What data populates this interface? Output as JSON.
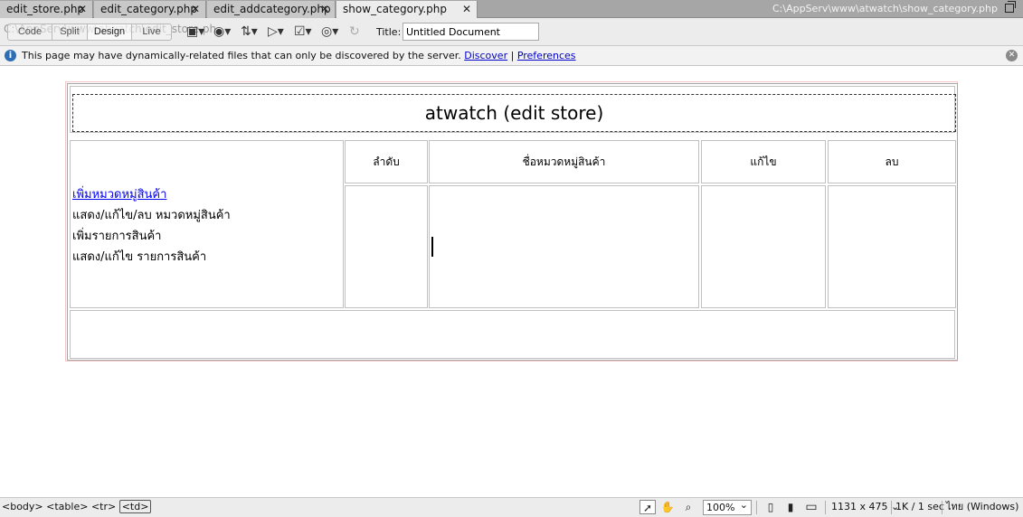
{
  "tabs": [
    {
      "label": "edit_store.php",
      "active": false
    },
    {
      "label": "edit_category.php",
      "active": false
    },
    {
      "label": "edit_addcategory.php",
      "active": false
    },
    {
      "label": "show_category.php",
      "active": true
    }
  ],
  "tab_close_glyph": "✕",
  "window_path": "C:\\AppServ\\www\\atwatch\\show_category.php",
  "toolbar": {
    "ghost_path": "C:\\AppServ\\www\\atwatch\\edit_store.ph",
    "code_label": "Code",
    "split_label": "Split",
    "design_label": "Design",
    "live_label": "Live",
    "title_label": "Title:",
    "title_value": "Untitled Document",
    "icons": [
      "multiscreen-icon",
      "preview-browser-icon",
      "file-management-icon",
      "visual-aids-icon",
      "validate-icon",
      "check-browser-icon",
      "refresh-icon"
    ]
  },
  "infobar": {
    "message": "This page may have dynamically-related files that can only be discovered by the server.",
    "discover_link": "Discover",
    "separator": "|",
    "preferences_link": "Preferences"
  },
  "page": {
    "heading": "atwatch (edit store)",
    "menu": [
      {
        "label": "เพิ่มหมวดหมู่สินค้า",
        "link": true
      },
      {
        "label": "แสดง/แก้ไข/ลบ หมวดหมู่สินค้า",
        "link": false
      },
      {
        "label": "เพิ่มรายการสินค้า",
        "link": false
      },
      {
        "label": "แสดง/แก้ไข รายการสินค้า",
        "link": false
      }
    ],
    "columns": [
      "ลำดับ",
      "ชื่อหมวดหมู่สินค้า",
      "แก้ไข",
      "ลบ"
    ]
  },
  "statusbar": {
    "tag_body": "<body>",
    "tag_table": "<table>",
    "tag_tr": "<tr>",
    "tag_td": "<td>",
    "zoom": "100%",
    "window_size": "1131 x 475",
    "size_caret": "⌄",
    "weight": "1K / 1 sec",
    "encoding": "ไทย (Windows)"
  }
}
